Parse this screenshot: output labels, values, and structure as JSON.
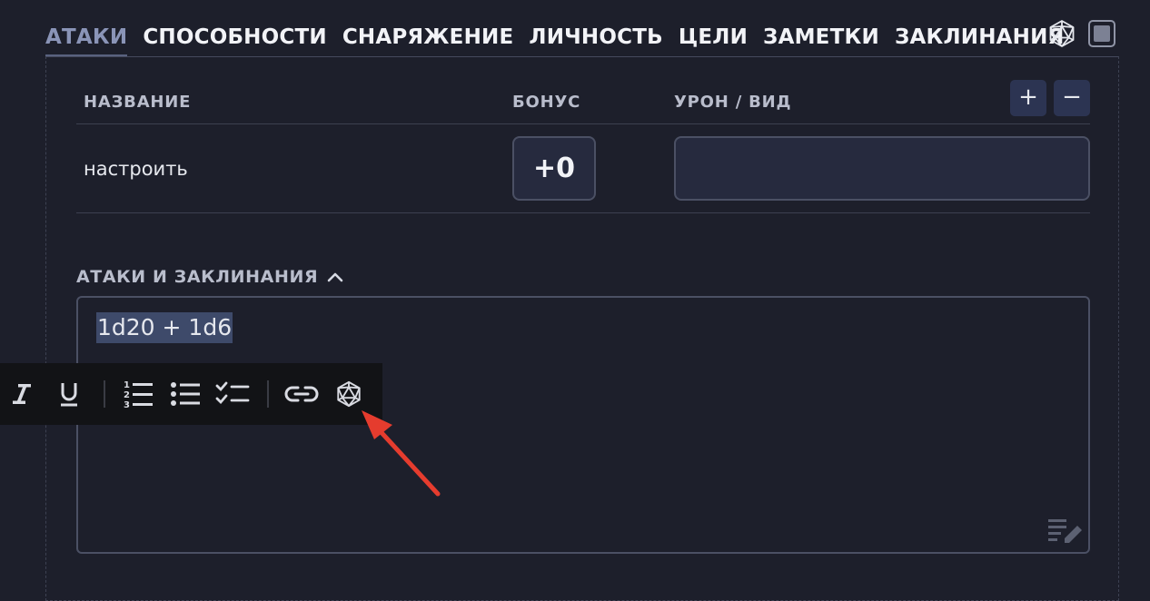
{
  "tabs": [
    {
      "label": "АТАКИ",
      "active": true
    },
    {
      "label": "СПОСОБНОСТИ"
    },
    {
      "label": "СНАРЯЖЕНИЕ"
    },
    {
      "label": "ЛИЧНОСТЬ"
    },
    {
      "label": "ЦЕЛИ"
    },
    {
      "label": "ЗАМЕТКИ"
    },
    {
      "label": "ЗАКЛИНАНИЯ"
    }
  ],
  "top_icons": [
    "d20-dice-icon",
    "square-toggle-icon"
  ],
  "table": {
    "headers": {
      "name": "НАЗВАНИЕ",
      "bonus": "БОНУС",
      "damage": "УРОН / ВИД"
    },
    "add_label": "+",
    "remove_label": "−",
    "rows": [
      {
        "name": "настроить",
        "bonus": "+0",
        "damage": ""
      }
    ]
  },
  "section": {
    "title": "АТАКИ И ЗАКЛИНАНИЯ",
    "chevron": "chevron-up-icon",
    "editor_text": "1d20 + 1d6"
  },
  "toolbar": {
    "items": [
      "italic-icon",
      "underline-icon",
      "ordered-list-icon",
      "bullet-list-icon",
      "checklist-icon",
      "link-icon",
      "d20-dice-icon"
    ]
  },
  "colors": {
    "background": "#1d1f2b",
    "active_tab": "#8a94b7",
    "button_bg": "#2c3452",
    "selection": "#3e4a6a",
    "arrow": "#e53c2e"
  }
}
